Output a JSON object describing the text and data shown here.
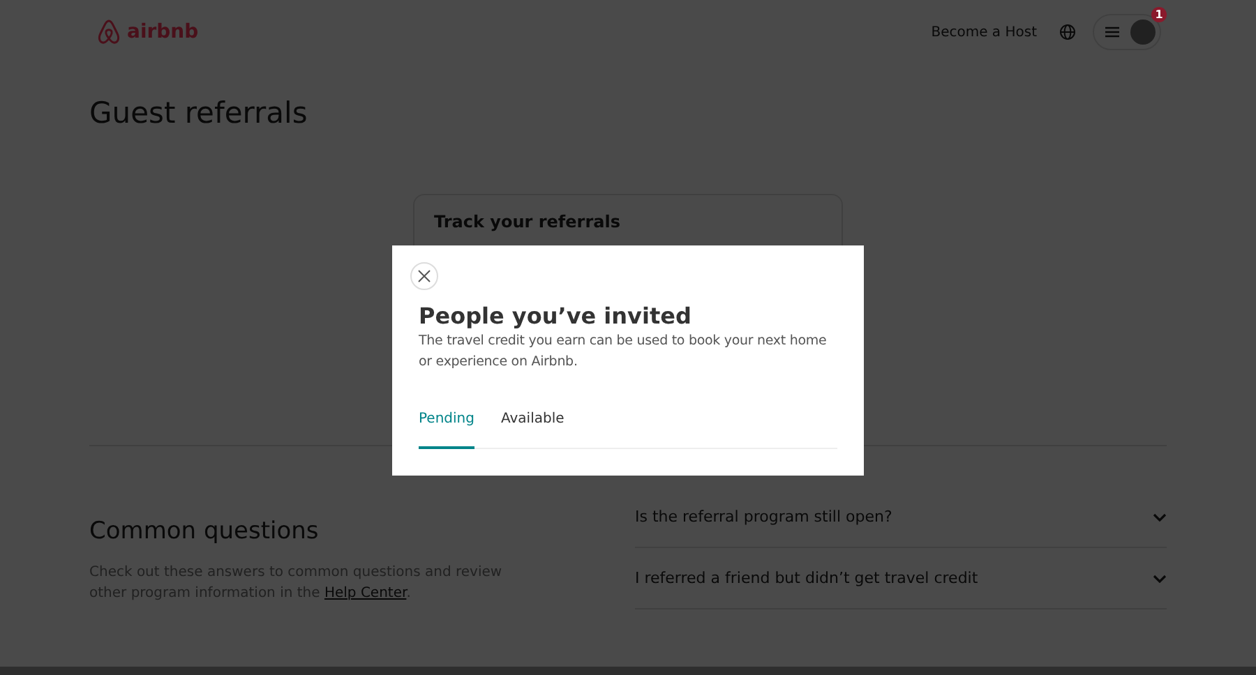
{
  "header": {
    "logo_text": "airbnb",
    "host_link": "Become a Host",
    "notification_count": "1"
  },
  "page_title": "Guest referrals",
  "tracker": {
    "title": "Track your referrals"
  },
  "questions": {
    "title": "Common questions",
    "description": "Check out these answers to common questions and review other program information in the ",
    "link": "Help Center",
    "after": ".",
    "items": [
      {
        "question": "Is the referral program still open?",
        "expanded": false
      },
      {
        "question": "I referred a friend but didn’t get travel credit",
        "expanded": false
      }
    ]
  },
  "modal": {
    "title": "People you’ve invited",
    "description": "The travel credit you earn can be used to book your next home or experience on Airbnb.",
    "tabs": [
      {
        "label": "Pending",
        "selected": true
      },
      {
        "label": "Available",
        "selected": false
      }
    ]
  }
}
